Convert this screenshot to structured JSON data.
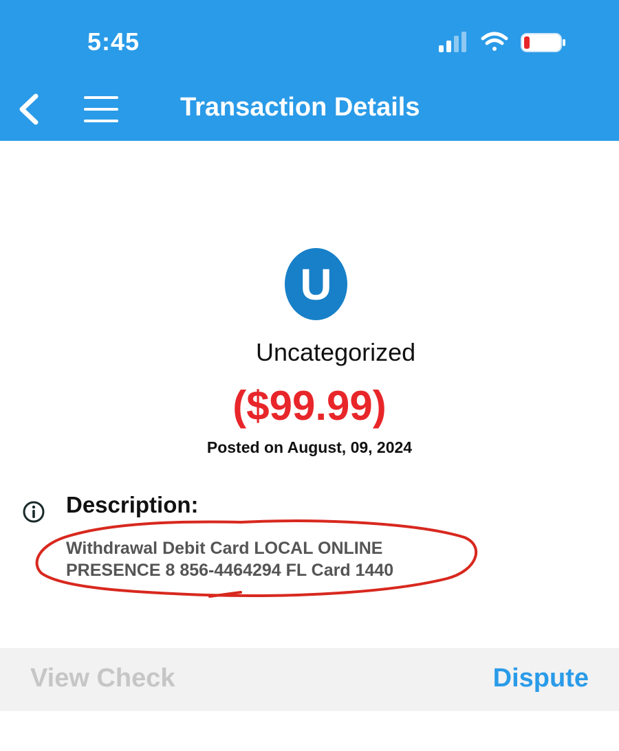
{
  "status_bar": {
    "time": "5:45",
    "icons": [
      "cellular-signal-icon",
      "wifi-icon",
      "battery-low-icon"
    ]
  },
  "nav": {
    "title": "Transaction Details",
    "back_icon": "chevron-left-icon",
    "menu_icon": "hamburger-menu-icon"
  },
  "transaction": {
    "category_initial": "U",
    "category": "Uncategorized",
    "amount": "($99.99)",
    "posted": "Posted on August, 09, 2024",
    "description_label": "Description:",
    "description": "Withdrawal Debit Card LOCAL ONLINE PRESENCE 8 856-4464294 FL Card 1440"
  },
  "actions": {
    "view_check": "View Check",
    "dispute": "Dispute"
  },
  "colors": {
    "header_bg": "#2a9be8",
    "badge_bg": "#1780c8",
    "amount": "#e8262a",
    "annotation": "#d8281e",
    "disabled_text": "#c6c6c6"
  }
}
